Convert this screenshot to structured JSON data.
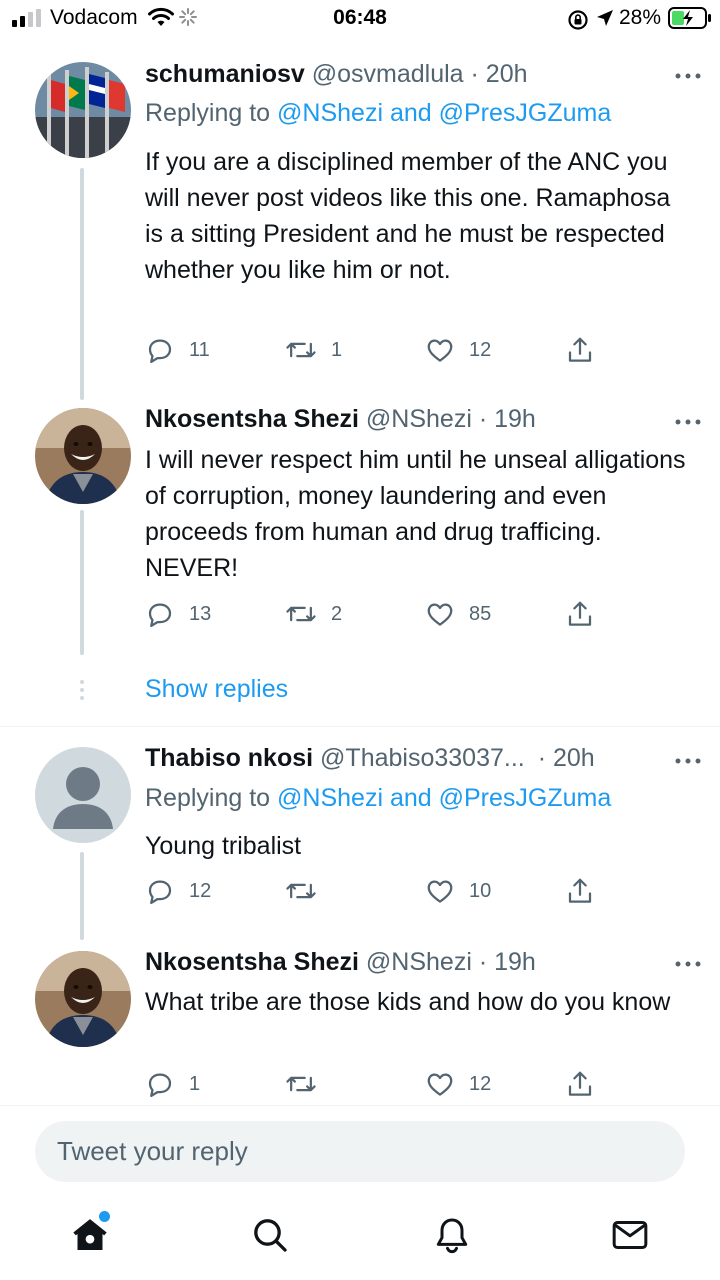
{
  "status_bar": {
    "carrier": "Vodacom",
    "time": "06:48",
    "battery_percent": "28%"
  },
  "tweets": [
    {
      "name": "schumaniosv",
      "handle": "@osvmadlula",
      "time": "· 20h",
      "replying_prefix": "Replying to",
      "replying_mentions": "@NShezi and @PresJGZuma",
      "text": "If you are a disciplined member of the ANC you will never post videos like this one. Ramaphosa is a sitting President and he must be respected whether you like him or not.",
      "replies": "11",
      "retweets": "1",
      "likes": "12"
    },
    {
      "name": "Nkosentsha Shezi",
      "handle": "@NShezi",
      "time": "· 19h",
      "text": "I will never respect him until he unseal alligations of corruption, money laundering and even proceeds from human and drug trafficing. NEVER!",
      "replies": "13",
      "retweets": "2",
      "likes": "85"
    },
    {
      "name": "Thabiso nkosi",
      "handle": "@Thabiso33037...",
      "time": "· 20h",
      "replying_prefix": "Replying to",
      "replying_mentions": "@NShezi and @PresJGZuma",
      "text": "Young tribalist",
      "replies": "12",
      "retweets": "",
      "likes": "10"
    },
    {
      "name": "Nkosentsha Shezi",
      "handle": "@NShezi",
      "time": "· 19h",
      "text": "What tribe are those kids and how do you know",
      "replies": "1",
      "retweets": "",
      "likes": "12"
    }
  ],
  "show_replies_label": "Show replies",
  "reply_bar": {
    "placeholder": "Tweet your reply"
  },
  "colors": {
    "accent": "#1d9bf0",
    "text_primary": "#0f1419",
    "text_secondary": "#536471",
    "thread_line": "#cfd9de",
    "battery_fill": "#4cd964"
  },
  "icons": [
    "home-icon",
    "search-icon",
    "bell-icon",
    "mail-icon",
    "reply-icon",
    "retweet-icon",
    "like-icon",
    "share-icon",
    "more-icon"
  ]
}
